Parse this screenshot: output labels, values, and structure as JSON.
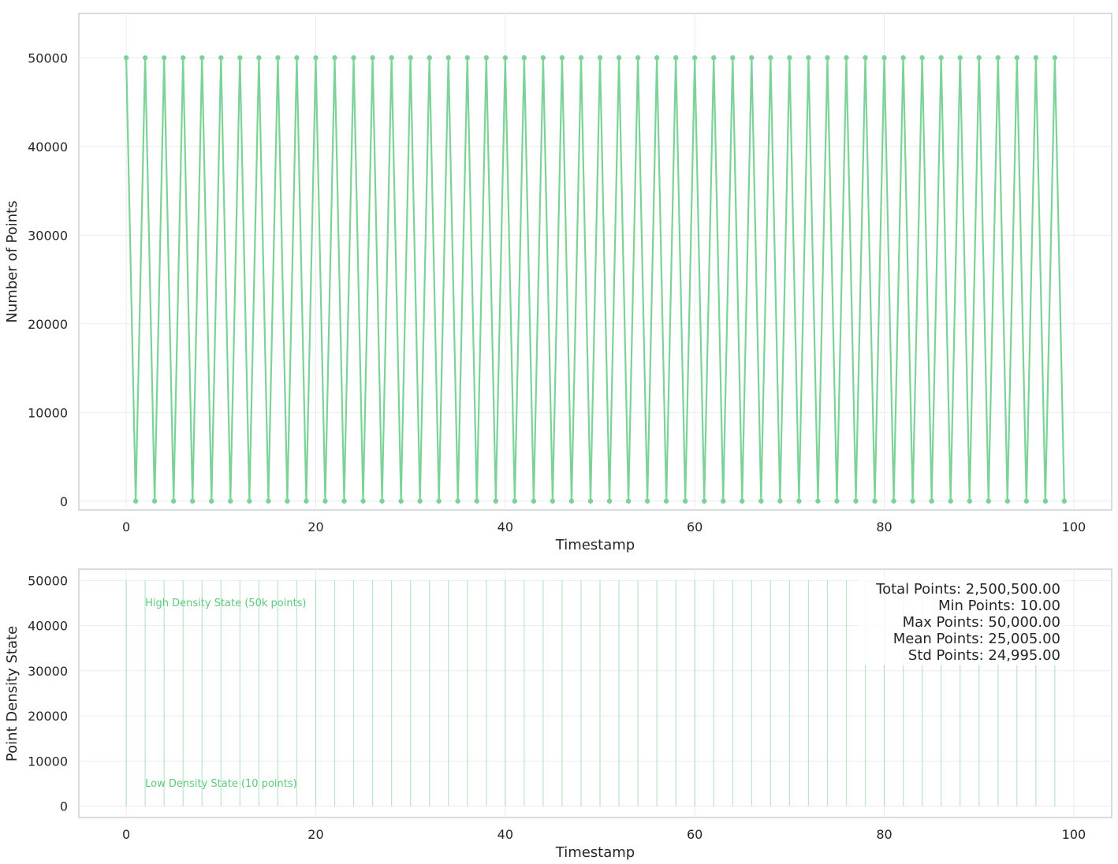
{
  "chart_data": [
    {
      "type": "line",
      "xlabel": "Timestamp",
      "ylabel": "Number of Points",
      "xlim": [
        -5,
        104
      ],
      "ylim": [
        -1000,
        55000
      ],
      "x_ticks": [
        0,
        20,
        40,
        60,
        80,
        100
      ],
      "y_ticks": [
        0,
        10000,
        20000,
        30000,
        40000,
        50000
      ],
      "grid": true,
      "legend": "none",
      "series_color": "#7bd397",
      "marker": "circle",
      "pattern_note": "alternating",
      "series": [
        {
          "x_start": 0,
          "x_end": 99,
          "values_pattern": [
            50000,
            10
          ]
        }
      ]
    },
    {
      "type": "line",
      "style": "vertical-lines",
      "xlabel": "Timestamp",
      "ylabel": "Point Density State",
      "xlim": [
        -5,
        104
      ],
      "ylim": [
        -2500,
        52500
      ],
      "x_ticks": [
        0,
        20,
        40,
        60,
        80,
        100
      ],
      "y_ticks": [
        0,
        10000,
        20000,
        30000,
        40000,
        50000
      ],
      "grid": true,
      "legend": "none",
      "series_color": "#7bd397",
      "vertical_lines_at_even_timestamps": {
        "from": 0,
        "to": 98,
        "step": 2,
        "top": 50000
      },
      "annotations": [
        {
          "text": "High Density State (50k points)",
          "x": 2,
          "y": 45000
        },
        {
          "text": "Low Density State (10 points)",
          "x": 2,
          "y": 5000
        }
      ],
      "stats_box": {
        "placement": "top-right",
        "lines": [
          "Total Points: 2,500,500.00",
          "Min Points: 10.00",
          "Max Points: 50,000.00",
          "Mean Points: 25,005.00",
          "Std Points: 24,995.00"
        ]
      }
    }
  ]
}
